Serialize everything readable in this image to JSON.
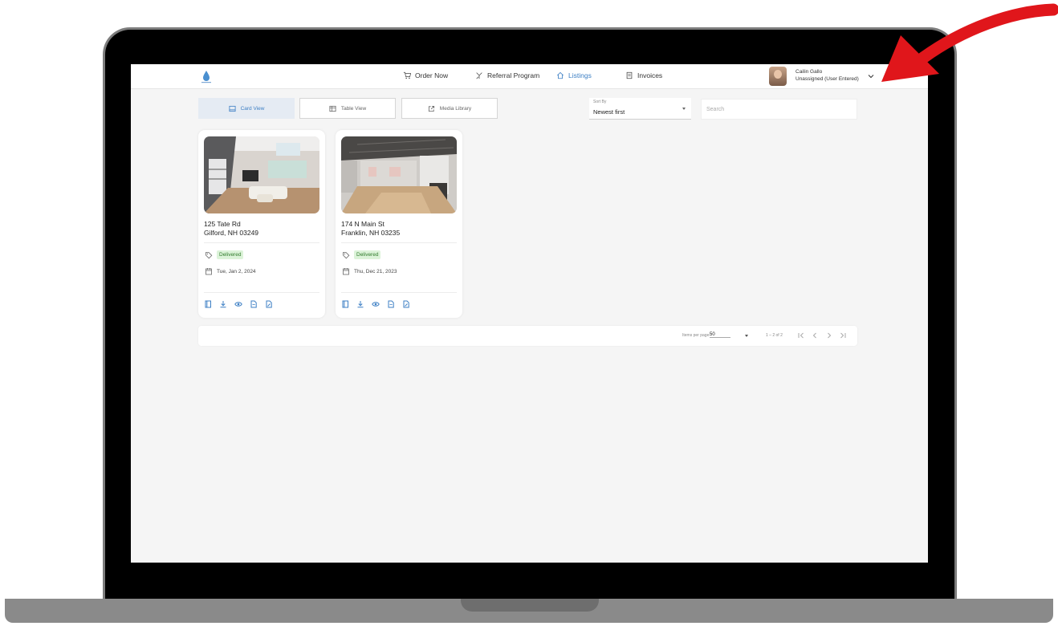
{
  "nav": {
    "order_now": "Order Now",
    "referral_program": "Referral Program",
    "listings": "Listings",
    "invoices": "Invoices"
  },
  "user": {
    "name": "Cailin Gallo",
    "role": "Unassigned (User Entered)"
  },
  "views": {
    "card_view": "Card View",
    "table_view": "Table View",
    "media_library": "Media Library"
  },
  "sort": {
    "label": "Sort By",
    "value": "Newest first"
  },
  "search": {
    "placeholder": "Search"
  },
  "listings": [
    {
      "address_line1": "125 Tate Rd",
      "address_line2": "Gilford, NH 03249",
      "status": "Delivered",
      "date": "Tue, Jan 2, 2024"
    },
    {
      "address_line1": "174 N Main St",
      "address_line2": "Franklin, NH 03235",
      "status": "Delivered",
      "date": "Thu, Dec 21, 2023"
    }
  ],
  "paginator": {
    "items_per_page_label": "Items per page:",
    "items_per_page": "50",
    "range": "1 – 2 of 2"
  },
  "colors": {
    "accent": "#3d7fc4",
    "delivered_bg": "#dcf3d9",
    "delivered_text": "#2f7a2a",
    "annotation_arrow": "#e0161b"
  },
  "icons": {
    "order_now": "cart-icon",
    "referral_program": "referral-icon",
    "listings": "home-icon",
    "invoices": "invoice-icon",
    "card_actions": [
      "book-icon",
      "download-icon",
      "eye-icon",
      "file-icon",
      "edit-file-icon"
    ]
  }
}
